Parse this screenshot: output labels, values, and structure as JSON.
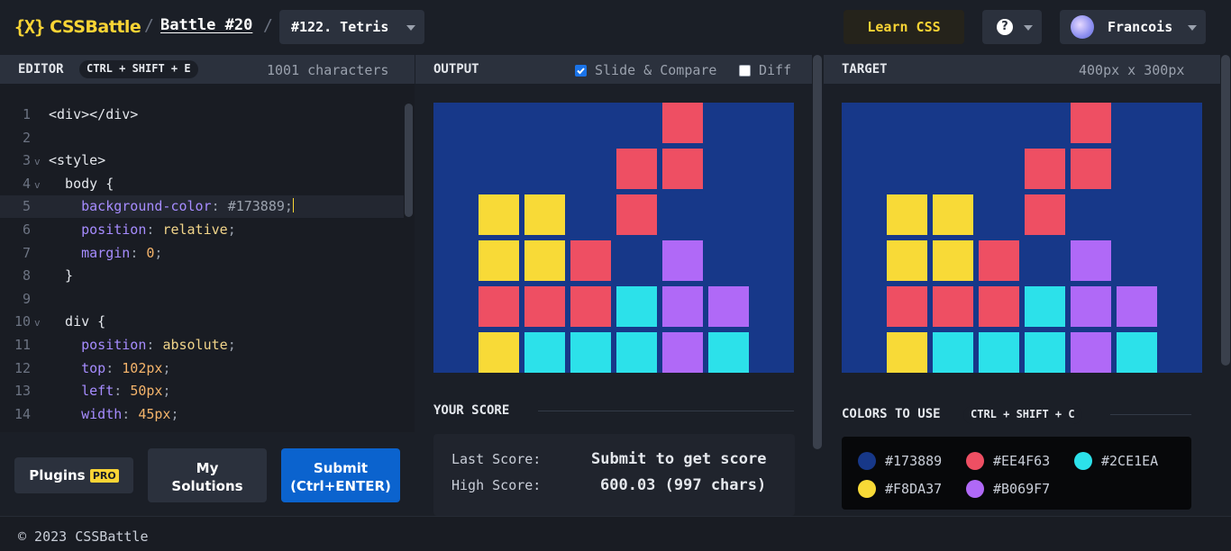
{
  "header": {
    "logo_mark": "{X}",
    "logo_text": "CSSBattle",
    "separator": "/",
    "battle_link": "Battle #20",
    "target_select": "#122. Tetris",
    "learn_button": "Learn CSS",
    "help_icon_label": "?",
    "user_name": "Francois"
  },
  "editor": {
    "title": "EDITOR",
    "shortcut": "CTRL + SHIFT + E",
    "char_count": "1001 characters",
    "lines": [
      {
        "n": "1",
        "code": "<div></div>"
      },
      {
        "n": "2",
        "code": ""
      },
      {
        "n": "3",
        "code": "<style>"
      },
      {
        "n": "4",
        "code": "  body {"
      },
      {
        "n": "5",
        "code": "    background-color: #173889;"
      },
      {
        "n": "6",
        "code": "    position: relative;"
      },
      {
        "n": "7",
        "code": "    margin: 0;"
      },
      {
        "n": "8",
        "code": "  }"
      },
      {
        "n": "9",
        "code": ""
      },
      {
        "n": "10",
        "code": "  div {"
      },
      {
        "n": "11",
        "code": "    position: absolute;"
      },
      {
        "n": "12",
        "code": "    top: 102px;"
      },
      {
        "n": "13",
        "code": "    left: 50px;"
      },
      {
        "n": "14",
        "code": "    width: 45px;"
      }
    ],
    "plugins_button": "Plugins",
    "pro_badge": "PRO",
    "my_solutions_line1": "My",
    "my_solutions_line2": "Solutions",
    "submit_line1": "Submit",
    "submit_line2": "(Ctrl+ENTER)"
  },
  "output": {
    "title": "OUTPUT",
    "slide_compare_label": "Slide & Compare",
    "slide_compare_checked": true,
    "diff_label": "Diff",
    "diff_checked": false
  },
  "target": {
    "title": "TARGET",
    "dimensions": "400px x 300px"
  },
  "score": {
    "title": "YOUR SCORE",
    "last_label": "Last Score:",
    "last_value": "Submit to get score",
    "high_label": "High Score:",
    "high_value": "600.03 (997 chars)"
  },
  "colors": {
    "title": "COLORS TO USE",
    "shortcut": "CTRL + SHIFT + C",
    "list": [
      {
        "hex": "#173889",
        "label": "#173889"
      },
      {
        "hex": "#EE4F63",
        "label": "#EE4F63"
      },
      {
        "hex": "#2CE1EA",
        "label": "#2CE1EA"
      },
      {
        "hex": "#F8DA37",
        "label": "#F8DA37"
      },
      {
        "hex": "#B069F7",
        "label": "#B069F7"
      }
    ]
  },
  "tetris_grid": {
    "background": "#173889",
    "cell_colors": {
      "Y": "#F8DA37",
      "R": "#EE4F63",
      "C": "#2CE1EA",
      "P": "#B069F7"
    },
    "rows": [
      ".....R..",
      "....RR..",
      ".YY.R...",
      ".YYR.P..",
      ".RRRCPP.",
      ".YCCCPC."
    ]
  },
  "footer": {
    "copyright": "© 2023 CSSBattle"
  },
  "theme": {
    "accent": "#f9d435",
    "submit_blue": "#0b63ce"
  }
}
